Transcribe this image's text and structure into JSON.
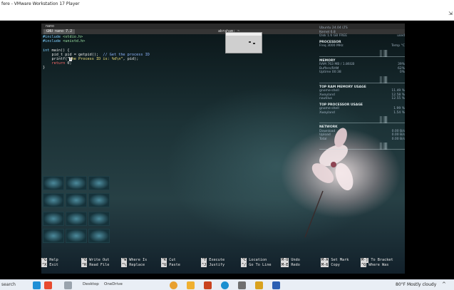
{
  "host": {
    "title": "fere - VMware Workstation 17 Player",
    "resize_glyph": "⇲"
  },
  "terminal": {
    "window_title": "nano",
    "tab_label": "GNU nano 7.2",
    "user_label": "abraham: ~",
    "code_lines": [
      {
        "parts": [
          {
            "t": "#include ",
            "c": "c-pre"
          },
          {
            "t": "<stdio.h>",
            "c": "c-inc"
          }
        ]
      },
      {
        "parts": [
          {
            "t": "#include ",
            "c": "c-pre"
          },
          {
            "t": "<unistd.h>",
            "c": "c-inc"
          }
        ]
      },
      {
        "parts": [
          {
            "t": "",
            "c": ""
          }
        ]
      },
      {
        "parts": [
          {
            "t": "int",
            "c": "c-type"
          },
          {
            "t": " main() {",
            "c": ""
          }
        ]
      },
      {
        "parts": [
          {
            "t": "    pid_t pid = getpid();  ",
            "c": ""
          },
          {
            "t": "// Get the process ID",
            "c": "c-cmt"
          }
        ]
      },
      {
        "parts": [
          {
            "t": "    printf(\"",
            "c": ""
          },
          {
            "t": "T",
            "c": "cursor"
          },
          {
            "t": "he Process ID is: %d\\n\"",
            "c": "c-str"
          },
          {
            "t": ", pid);",
            "c": ""
          }
        ]
      },
      {
        "parts": [
          {
            "t": "    ",
            "c": ""
          },
          {
            "t": "return",
            "c": "c-kw"
          },
          {
            "t": " 0;",
            "c": ""
          }
        ]
      },
      {
        "parts": [
          {
            "t": "}",
            "c": ""
          }
        ]
      }
    ]
  },
  "conky": {
    "sections": [
      {
        "header": "",
        "rows": [
          [
            "Ubuntu 24.04 LTS",
            ""
          ],
          [
            "Kernel 6.8",
            ""
          ],
          [
            "Disk 1.6 GB FREE",
            "used"
          ]
        ]
      },
      {
        "header": "PROCESSOR",
        "rows": [
          [
            "Freq 3000 MHz",
            "Temp °C"
          ]
        ],
        "graph": true
      },
      {
        "header": "MEMORY",
        "rows": [
          [
            "RAM 763 MB / 1.86GB",
            "39%"
          ],
          [
            "Buffers/RAM",
            "62%"
          ],
          [
            "Uptime 00:38",
            "0%"
          ]
        ],
        "graph": true
      },
      {
        "header": "TOP RAM MEMORY USAGE",
        "rows": [
          [
            "gnome-shell",
            "11.49 %"
          ],
          [
            "Xwayland",
            "12.58 %"
          ],
          [
            "nautilus",
            "12.55 %"
          ]
        ]
      },
      {
        "header": "TOP PROCESSOR USAGE",
        "rows": [
          [
            "gnome-shell",
            "1.99 %"
          ],
          [
            "Xwayland",
            "1.54 %"
          ]
        ],
        "graph": true
      },
      {
        "header": "NETWORK",
        "rows": [
          [
            "Download",
            "0.00 B/s"
          ],
          [
            "Upload",
            "0.00 B/s"
          ],
          [
            "Total",
            "0.00 B/s"
          ]
        ],
        "graph": true
      }
    ]
  },
  "shortcuts": [
    {
      "k1": "^G",
      "l1": "Help",
      "k2": "^X",
      "l2": "Exit"
    },
    {
      "k1": "^O",
      "l1": "Write Out",
      "k2": "^R",
      "l2": "Read File"
    },
    {
      "k1": "^W",
      "l1": "Where Is",
      "k2": "^\\",
      "l2": "Replace"
    },
    {
      "k1": "^K",
      "l1": "Cut",
      "k2": "^U",
      "l2": "Paste"
    },
    {
      "k1": "^T",
      "l1": "Execute",
      "k2": "^J",
      "l2": "Justify"
    },
    {
      "k1": "^C",
      "l1": "Location",
      "k2": "^/",
      "l2": "Go To Line"
    },
    {
      "k1": "M-U",
      "l1": "Undo",
      "k2": "M-E",
      "l2": "Redo"
    },
    {
      "k1": "M-A",
      "l1": "Set Mark",
      "k2": "M-6",
      "l2": "Copy"
    },
    {
      "k1": "M-]",
      "l1": "To Bracket",
      "k2": "^Q",
      "l2": "Where Was"
    }
  ],
  "taskbar": {
    "search_label": "search",
    "desktop_label": "Desktop",
    "onedrive_label": "OneDrive",
    "weather": "80°F  Mostly cloudy",
    "tray_chevron": "^",
    "colors": {
      "chrome": "#e8a030",
      "files": "#f0b030",
      "powerpoint": "#c9431f",
      "edge": "#1a8fd0",
      "word": "#2b5fb3",
      "vmware": "#6f6f6f"
    }
  }
}
